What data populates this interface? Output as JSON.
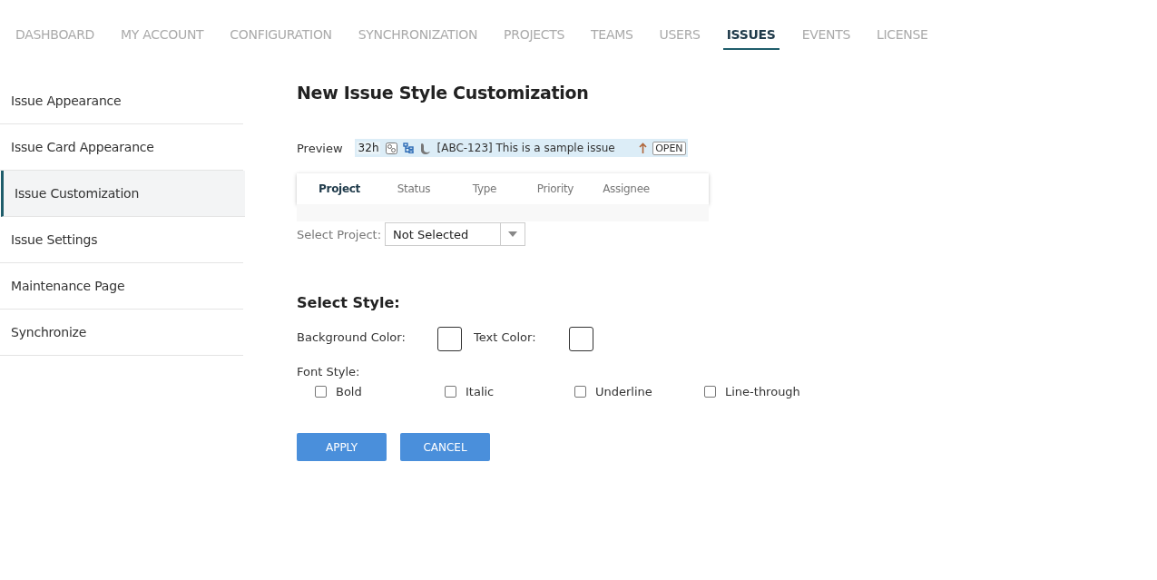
{
  "nav": [
    {
      "label": "DASHBOARD",
      "selected": false
    },
    {
      "label": "MY ACCOUNT",
      "selected": false
    },
    {
      "label": "CONFIGURATION",
      "selected": false
    },
    {
      "label": "SYNCHRONIZATION",
      "selected": false
    },
    {
      "label": "PROJECTS",
      "selected": false
    },
    {
      "label": "TEAMS",
      "selected": false
    },
    {
      "label": "USERS",
      "selected": false
    },
    {
      "label": "ISSUES",
      "selected": true
    },
    {
      "label": "EVENTS",
      "selected": false
    },
    {
      "label": "LICENSE",
      "selected": false
    }
  ],
  "sidebar": {
    "items": [
      {
        "label": "Issue Appearance",
        "selected": false
      },
      {
        "label": "Issue Card Appearance",
        "selected": false
      },
      {
        "label": "Issue Customization",
        "selected": true
      },
      {
        "label": "Issue Settings",
        "selected": false
      },
      {
        "label": "Maintenance Page",
        "selected": false
      },
      {
        "label": "Synchronize",
        "selected": false
      }
    ]
  },
  "title": "New Issue Style Customization",
  "preview": {
    "label": "Preview",
    "estimate": "32h",
    "issue": "[ABC-123] This is a sample issue",
    "status": "OPEN"
  },
  "tabs": [
    {
      "label": "Project",
      "selected": true
    },
    {
      "label": "Status",
      "selected": false
    },
    {
      "label": "Type",
      "selected": false
    },
    {
      "label": "Priority",
      "selected": false
    },
    {
      "label": "Assignee",
      "selected": false
    }
  ],
  "project_select": {
    "label": "Select Project:",
    "value": "Not Selected"
  },
  "style": {
    "heading": "Select Style:",
    "background_label": "Background Color:",
    "text_label": "Text Color:",
    "font_label": "Font Style:",
    "font_options": [
      {
        "label": "Bold",
        "checked": false
      },
      {
        "label": "Italic",
        "checked": false
      },
      {
        "label": "Underline",
        "checked": false
      },
      {
        "label": "Line-through",
        "checked": false
      }
    ]
  },
  "buttons": [
    "APPLY",
    "CANCEL"
  ]
}
